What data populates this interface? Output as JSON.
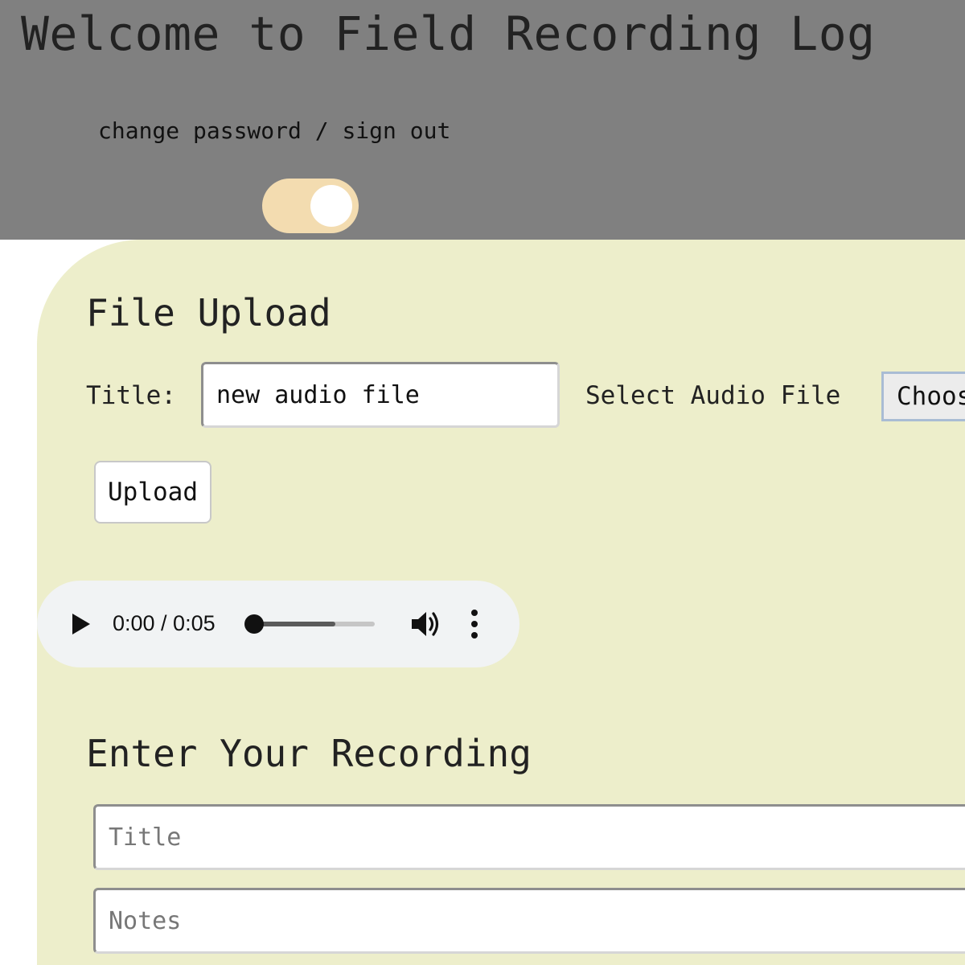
{
  "header": {
    "app_title": "Welcome to Field Recording Log",
    "account_links": {
      "change_password": "change password",
      "separator": " / ",
      "sign_out": "sign out"
    },
    "theme_toggle": {
      "on": true,
      "track_color": "#f3dcb0"
    }
  },
  "file_upload": {
    "heading": "File Upload",
    "title_label": "Title:",
    "title_value": "new audio file",
    "select_label": "Select Audio File",
    "choose_button": "Choose File",
    "upload_button": "Upload"
  },
  "audio_player": {
    "time": "0:00 / 0:05",
    "position_fraction": 0,
    "buffered_fraction": 0.67
  },
  "recording_form": {
    "heading": "Enter Your Recording",
    "title_placeholder": "Title",
    "notes_placeholder": "Notes"
  },
  "colors": {
    "header_bg": "#808080",
    "panel_bg": "#edeecb"
  }
}
